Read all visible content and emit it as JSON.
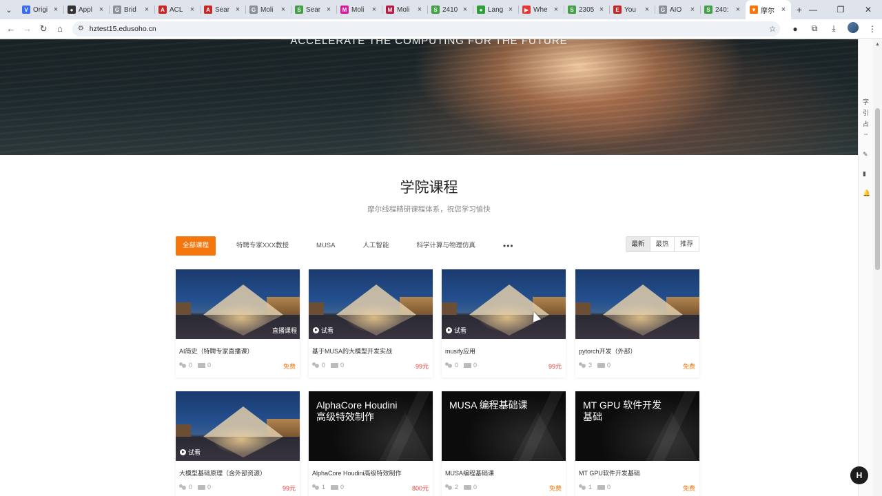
{
  "browser": {
    "tabs": [
      {
        "label": "Origi",
        "color": "#3a6cf0",
        "glyph": "V"
      },
      {
        "label": "Appl",
        "color": "#333333",
        "glyph": "●"
      },
      {
        "label": "Brid",
        "color": "#8a8f98",
        "glyph": "G"
      },
      {
        "label": "ACL",
        "color": "#c62828",
        "glyph": "A"
      },
      {
        "label": "Sear",
        "color": "#c62828",
        "glyph": "A"
      },
      {
        "label": "Moli",
        "color": "#8a8f98",
        "glyph": "G"
      },
      {
        "label": "Sear",
        "color": "#43a047",
        "glyph": "S"
      },
      {
        "label": "Moli",
        "color": "#d81b9c",
        "glyph": "M"
      },
      {
        "label": "Moli",
        "color": "#b71c45",
        "glyph": "M"
      },
      {
        "label": "2410",
        "color": "#43a047",
        "glyph": "S"
      },
      {
        "label": "Lang",
        "color": "#2e9d3a",
        "glyph": "●"
      },
      {
        "label": "Whe",
        "color": "#e53935",
        "glyph": "▶"
      },
      {
        "label": "2305",
        "color": "#43a047",
        "glyph": "S"
      },
      {
        "label": "You",
        "color": "#c62828",
        "glyph": "E"
      },
      {
        "label": "AIO",
        "color": "#8a8f98",
        "glyph": "G"
      },
      {
        "label": "240:",
        "color": "#43a047",
        "glyph": "S"
      },
      {
        "label": "摩尔",
        "color": "#f5760c",
        "glyph": "▼",
        "active": true
      }
    ],
    "url": "hztest15.edusoho.cn"
  },
  "hero": {
    "slogan": "ACCELERATE THE COMPUTING FOR THE FUTURE"
  },
  "section": {
    "title": "学院课程",
    "subtitle": "摩尔线程精研课程体系，祝您学习愉快"
  },
  "filters": {
    "items": [
      "全部课程",
      "特聘专家XXX教授",
      "MUSA",
      "人工智能",
      "科学计算与物理仿真"
    ],
    "more": "•••",
    "active_index": 0
  },
  "sort": {
    "items": [
      "最新",
      "最热",
      "推荐"
    ],
    "active_index": 0
  },
  "courses": [
    {
      "title": "AI简史（特聘专家直播课）",
      "students": "0",
      "comments": "0",
      "price": "免费",
      "free": true,
      "thumb": "louvre",
      "badge": "直播课程"
    },
    {
      "title": "基于MUSA的大模型开发实战",
      "students": "0",
      "comments": "0",
      "price": "99元",
      "free": false,
      "thumb": "louvre",
      "trial": "试看"
    },
    {
      "title": "musify应用",
      "students": "0",
      "comments": "0",
      "price": "99元",
      "free": false,
      "thumb": "louvre",
      "trial": "试看"
    },
    {
      "title": "pytorch开发（外部）",
      "students": "3",
      "comments": "0",
      "price": "免费",
      "free": true,
      "thumb": "louvre"
    },
    {
      "title": "大模型基础原理（含外部资源）",
      "students": "0",
      "comments": "0",
      "price": "99元",
      "free": false,
      "thumb": "louvre",
      "trial": "试看"
    },
    {
      "title": "AlphaCore Houdini高级特效制作",
      "students": "1",
      "comments": "0",
      "price": "800元",
      "free": false,
      "thumb": "dark",
      "cover_text": "AlphaCore Houdini\n高级特效制作"
    },
    {
      "title": "MUSA编程基础课",
      "students": "2",
      "comments": "0",
      "price": "免费",
      "free": true,
      "thumb": "dark",
      "cover_text": "MUSA 编程基础课"
    },
    {
      "title": "MT GPU软件开发基础",
      "students": "1",
      "comments": "0",
      "price": "免费",
      "free": true,
      "thumb": "dark",
      "cover_text": "MT GPU 软件开发\n基础"
    }
  ]
}
